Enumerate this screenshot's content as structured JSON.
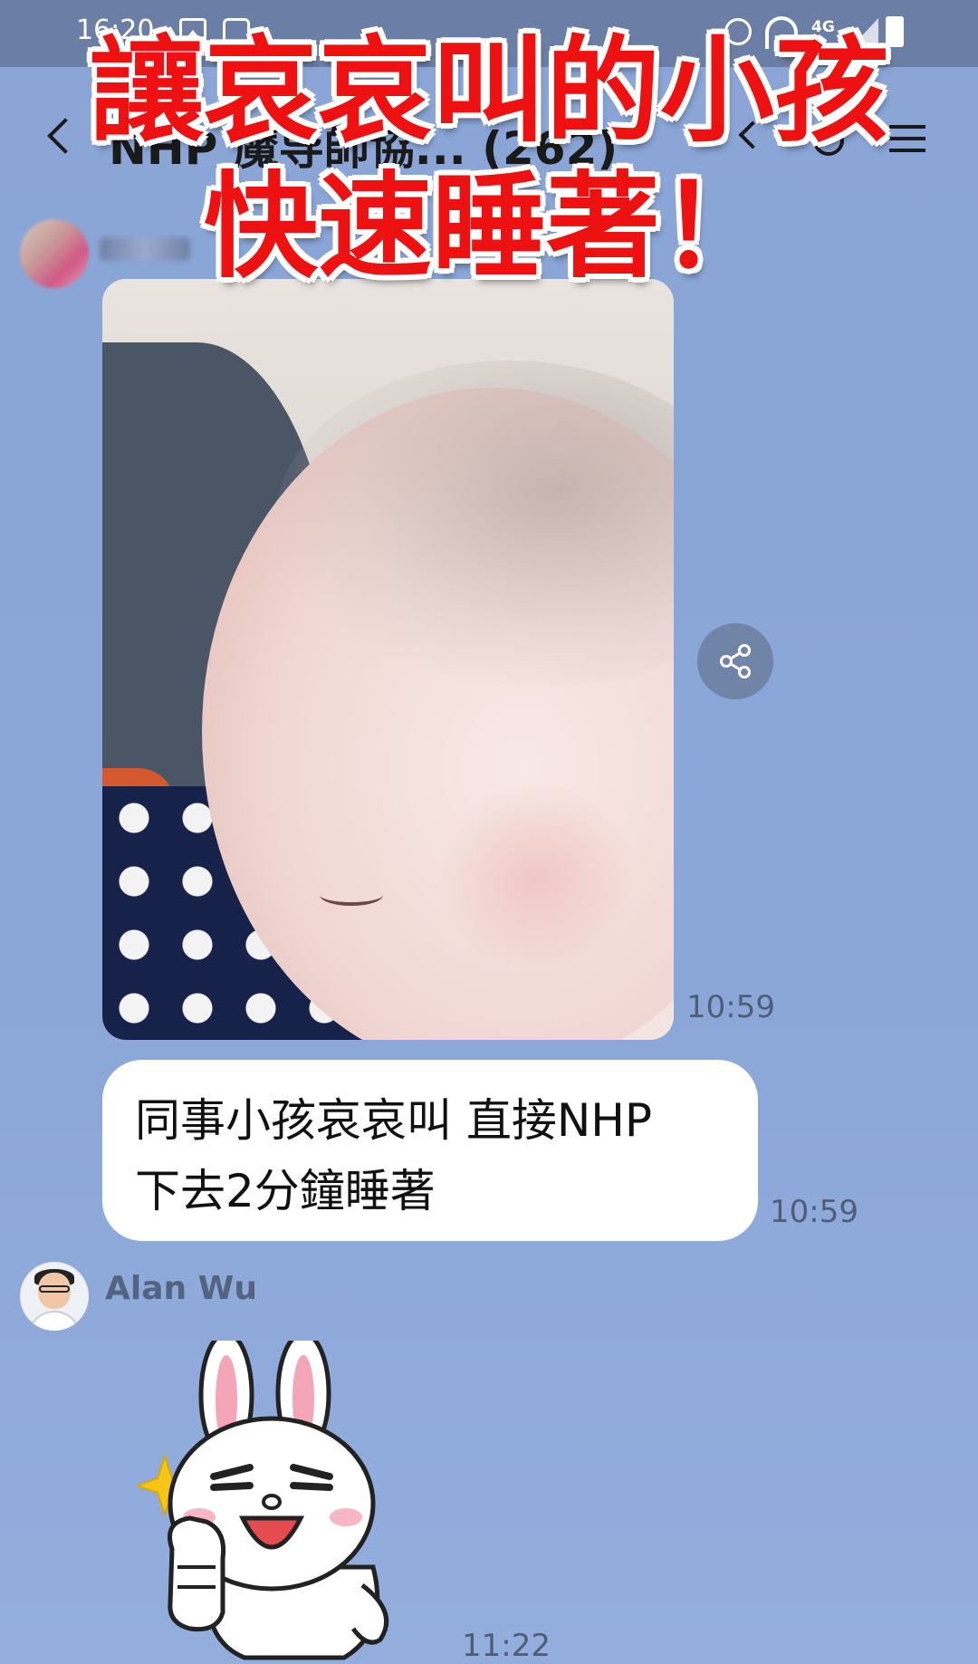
{
  "status_bar": {
    "time": "16:20",
    "network": "4G"
  },
  "header": {
    "title": "NHP 魔导師協... (262)"
  },
  "overlay": {
    "line1": "讓哀哀叫的小孩",
    "line2": "快速睡著！",
    "color": "#ee1111"
  },
  "messages": [
    {
      "type": "photo",
      "time": "10:59"
    },
    {
      "type": "text",
      "lines": [
        "同事小孩哀哀叫 直接NHP",
        "下去2分鐘睡著"
      ],
      "time": "10:59"
    },
    {
      "type": "sticker",
      "sender": "Alan Wu",
      "time": "11:22"
    }
  ],
  "icons": {
    "share": "share-icon",
    "back": "back-icon"
  },
  "colors": {
    "chat_background": "#8aa5d6",
    "bubble": "#ffffff",
    "timestamp": "#4f5d75"
  }
}
